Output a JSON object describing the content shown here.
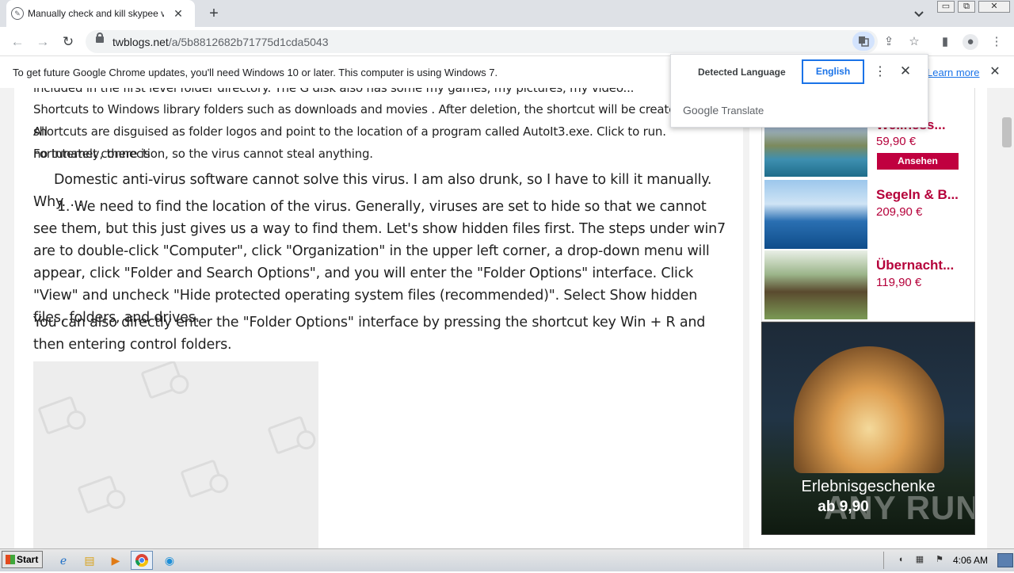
{
  "browser": {
    "tab": {
      "title": "Manually check and kill skypee virus",
      "close": "✕"
    },
    "new_tab": "+",
    "url_host": "twblogs.net",
    "url_path": "/a/5b8812682b71775d1cda5043",
    "window_controls": [
      "▭",
      "⧉",
      "✕"
    ]
  },
  "infobar": {
    "message": "To get future Google Chrome updates, you'll need Windows 10 or later. This computer is using Windows 7.",
    "learn_more": "Learn more",
    "close": "✕"
  },
  "translate_popup": {
    "detected_label": "Detected Language",
    "target_language": "English",
    "brand_google": "Google",
    "brand_translate": "Translate"
  },
  "article": {
    "paragraphs_small": [
      "included in the first level folder directory. The G disk also has some my games, my pictures, my video...",
      "Shortcuts to Windows library folders such as downloads and movies . After deletion, the shortcut will be created again. All",
      "shortcuts are disguised as folder logos and point to the location of a program called AutoIt3.exe. Click to run. Fortunately, there is",
      "no Internet connection, so the virus cannot steal anything."
    ],
    "p1": "Domestic anti-virus software cannot solve this virus. I am also drunk, so I have to kill it manually. Why. . .",
    "p2": "1. We need to find the location of the virus. Generally, viruses are set to hide so that we cannot see them, but this just gives us a way to find them. Let's show hidden files first. The steps under win7 are to double-click \"Computer\", click \"Organization\" in the upper left corner, a drop-down menu will appear, click \"Folder and Search Options\", and you will enter the \"Folder Options\" interface. Click \"View\" and uncheck \"Hide protected operating system files (recommended)\". Select Show hidden files, folders, and drives.",
    "p3": "You can also directly enter the \"Folder Options\" interface by pressing the shortcut key Win + R and then entering control folders."
  },
  "ads": {
    "items": [
      {
        "title": "Wellness...",
        "price": "59,90 €",
        "button": "Ansehen"
      },
      {
        "title": "Segeln & B...",
        "price": "209,90 €"
      },
      {
        "title": "Übernacht...",
        "price": "119,90 €"
      }
    ],
    "banner_text": "Erlebnisgeschenke",
    "banner_price": "ab 9,90",
    "watermark": "ANY RUN"
  },
  "taskbar": {
    "start": "Start",
    "clock": "4:06 AM",
    "apps": [
      "ie-icon",
      "folder-icon",
      "media-icon",
      "chrome-icon",
      "edge-icon"
    ]
  },
  "colors": {
    "ad_red": "#b5003a",
    "chrome_blue": "#1a73e8",
    "tabstrip": "#dee1e6"
  }
}
